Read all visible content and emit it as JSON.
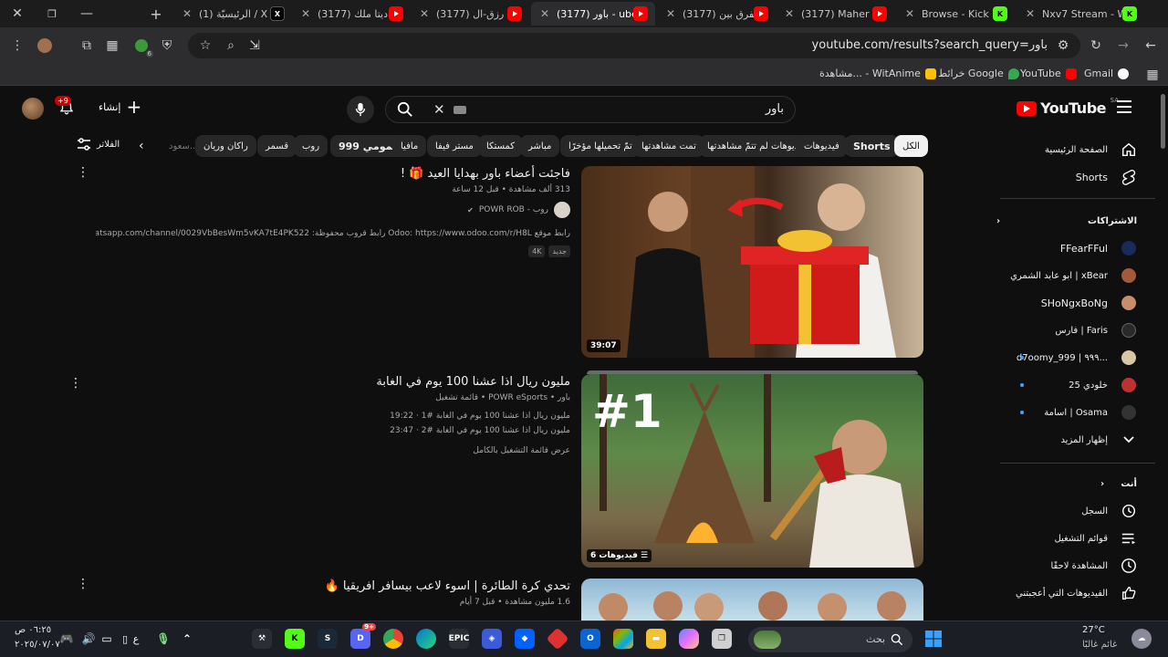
{
  "browser": {
    "tabs": [
      {
        "title": "(1) الرئيسيّة / X",
        "icon": "x"
      },
      {
        "title": "(3177) ناديتا ملك...",
        "icon": "yt"
      },
      {
        "title": "(3177) رشا رزق-ال...",
        "icon": "yt"
      },
      {
        "title": "(3177) باور - ube",
        "icon": "yt",
        "active": true
      },
      {
        "title": "(3177) الفرق بين",
        "icon": "yt"
      },
      {
        "title": "(3177) Maher Za",
        "icon": "yt"
      },
      {
        "title": "Browse - Kick Str",
        "icon": "kick"
      },
      {
        "title": "Nxv7 Stream - W",
        "icon": "kick"
      }
    ],
    "url": "youtube.com/results?search_query=باور",
    "bookmarks": [
      {
        "label": "Gmail",
        "color": "#ffffff"
      },
      {
        "label": "YouTube",
        "color": "#ff0000"
      },
      {
        "label": "خرائط Google",
        "color": "#34a853"
      },
      {
        "label": "مشاهدة... - WitAnime",
        "color": "#ffc107"
      }
    ],
    "extension_badge": "6"
  },
  "youtube": {
    "logo_text": "YouTube",
    "country_code": "SA",
    "search_query": "باور",
    "create_label": "إنشاء",
    "notif_count": "+9",
    "filters_label": "الفلاتر",
    "chips": [
      "الكل",
      "Shorts",
      "فيديوهات",
      "فيديوهات لم تتمّ مشاهدتها",
      "تمت مشاهدتها",
      "تمّ تحميلها مؤخرًا",
      "مباشر",
      "كمستكا",
      "مستر فيفا",
      "مافيا",
      "حمومي 999",
      "روب",
      "قسمر",
      "راكان وريان",
      "سعود..."
    ]
  },
  "results": [
    {
      "title": "فاجئت أعضاء باور بهدايا العيد 🎁 !",
      "views_age": "313 ألف مشاهدة • قبل 12 ساعة",
      "channel": "روب - POWR ROB",
      "description": "رابط موقع Odoo: https://www.odoo.com/r/H8L رابط قروب محفوظة: https://whatsapp.com/channel/0029VbBesWm5vKA7tE4PK522 لا ...",
      "tags": [
        "جديد",
        "4K"
      ],
      "duration": "39:07"
    },
    {
      "title": "مليون ريال اذا عشنا 100 يوم في الغابة",
      "channel_line": "باور • POWR eSports • قائمة تشغيل",
      "playlist_items": [
        "مليون ريال اذا عشنا 100 يوم في الغابة #1 · 19:22",
        "مليون ريال اذا عشنا 100 يوم في الغابة #2 · 23:47"
      ],
      "view_full": "عرض قائمة التشغيل بالكامل",
      "video_count": "6 فيديوهات"
    },
    {
      "title": "تحدي كرة الطائرة | اسوء لاعب بيسافر افريقيا 🔥",
      "views_age": "1.6 مليون مشاهدة • قبل 7 أيام"
    }
  ],
  "sidebar": {
    "main": [
      {
        "label": "الصفحة الرئيسية",
        "icon": "home-icon"
      },
      {
        "label": "Shorts",
        "icon": "shorts-icon"
      }
    ],
    "subs_header": "الاشتراكات",
    "subs": [
      {
        "label": "FFearFFul",
        "color": "#1a2a5a",
        "live": false
      },
      {
        "label": "ابو عابد الشمري | xBear",
        "color": "#a45a3a",
        "live": false
      },
      {
        "label": "SHoNgxBoNg",
        "color": "#c88e6b",
        "live": false
      },
      {
        "label": "فارس | Faris",
        "color": "#2a2a2a",
        "live": false
      },
      {
        "label": "d7oomy_999 | ٩٩٩...",
        "color": "#d9c6a5",
        "live": true
      },
      {
        "label": "خلودي 25",
        "color": "#c03030",
        "live": true
      },
      {
        "label": "اسامة | Osama",
        "color": "#333333",
        "live": true
      }
    ],
    "show_more": "إظهار المزيد",
    "you_header": "أنت",
    "you": [
      {
        "label": "السجل",
        "icon": "history-icon"
      },
      {
        "label": "قوائم التشغيل",
        "icon": "playlist-icon"
      },
      {
        "label": "المشاهدة لاحقًا",
        "icon": "clock-icon"
      },
      {
        "label": "الفيديوهات التي أعجبتني",
        "icon": "thumbs-up-icon"
      }
    ]
  },
  "taskbar": {
    "search_placeholder": "بحث",
    "weather_temp": "27°C",
    "weather_desc": "غائم غالبًا",
    "time": "٠٦:٢٥ ص",
    "date": "٢٠٢٥/٠٧/٠٧",
    "lang": "ع",
    "discord_badge": "9+"
  }
}
